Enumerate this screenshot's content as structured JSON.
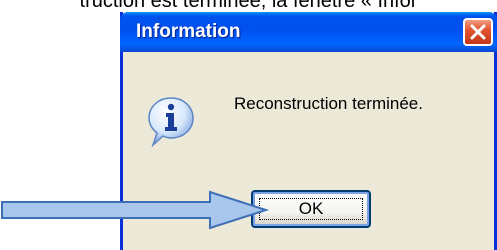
{
  "caption": "truction est terminée, la fenêtre « Infor",
  "dialog": {
    "title": "Information",
    "message": "Reconstruction terminée.",
    "ok_label": "OK"
  },
  "icons": {
    "close": "close-icon",
    "info": "info-icon",
    "arrow": "arrow-right-icon"
  },
  "colors": {
    "titlebar": "#0053ee",
    "body": "#ece9d8",
    "close_button": "#e3552f",
    "arrow_fill": "#a9c6ec",
    "arrow_stroke": "#3d6fb6"
  }
}
